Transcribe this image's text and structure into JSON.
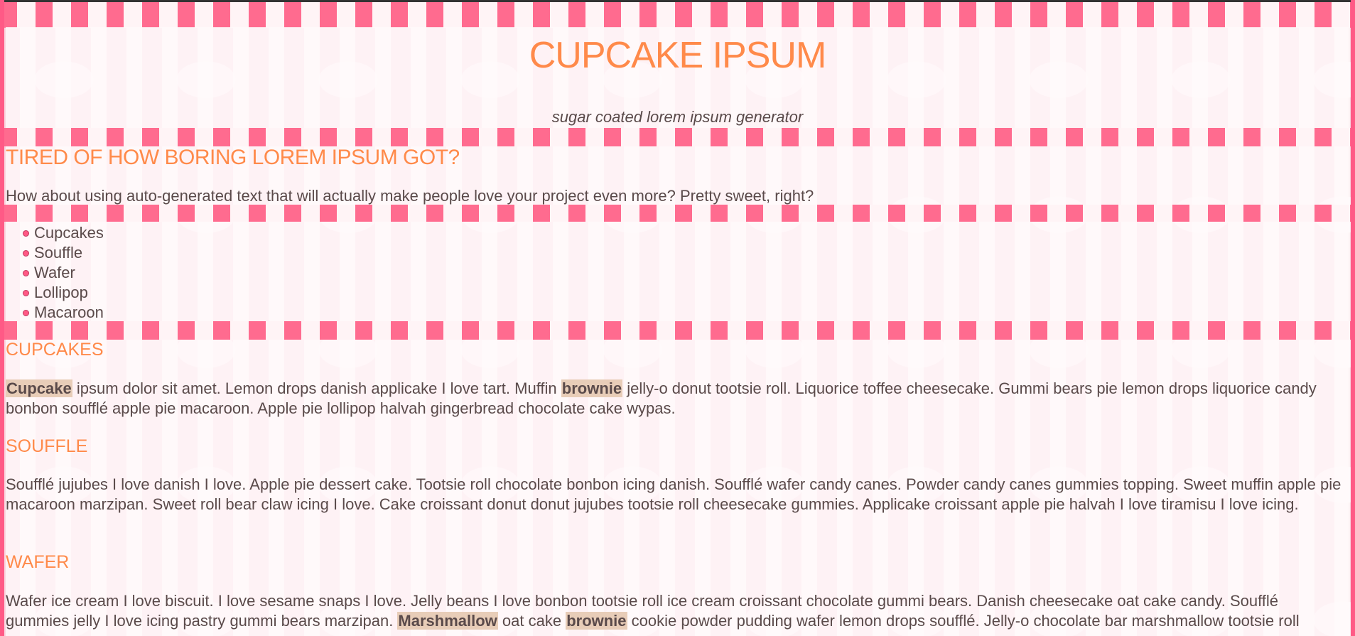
{
  "site": {
    "title": "CUPCAKE IPSUM",
    "tagline": "sugar coated lorem ipsum generator"
  },
  "intro": {
    "heading": "TIRED OF HOW BORING LOREM IPSUM GOT?",
    "text": "How about using auto-generated text that will actually make people love your project even more? Pretty sweet, right?"
  },
  "menu": {
    "items": [
      "Cupcakes",
      "Souffle",
      "Wafer",
      "Lollipop",
      "Macaroon"
    ]
  },
  "sections": {
    "cupcakes": {
      "heading": "CUPCAKES",
      "hl1": "Cupcake",
      "part1": " ipsum dolor sit amet. Lemon drops danish applicake I love tart. Muffin ",
      "hl2": "brownie",
      "part2": " jelly-o donut tootsie roll. Liquorice toffee cheesecake. Gummi bears pie lemon drops liquorice candy bonbon soufflé apple pie macaroon. Apple pie lollipop halvah gingerbread chocolate cake wypas."
    },
    "souffle": {
      "heading": "SOUFFLE",
      "text": "Soufflé jujubes I love danish I love. Apple pie dessert cake. Tootsie roll chocolate bonbon icing danish. Soufflé wafer candy canes. Powder candy canes gummies topping. Sweet muffin apple pie macaroon marzipan. Sweet roll bear claw icing I love. Cake croissant donut donut jujubes tootsie roll cheesecake gummies. Applicake croissant apple pie halvah I love tiramisu I love icing."
    },
    "wafer": {
      "heading": "WAFER",
      "part1": "Wafer ice cream I love biscuit. I love sesame snaps I love. Jelly beans I love bonbon tootsie roll ice cream croissant chocolate gummi bears. Danish cheesecake oat cake candy. Soufflé gummies jelly I love icing pastry gummi bears marzipan. ",
      "hl1": "Marshmallow",
      "part2": " oat cake ",
      "hl2": "brownie",
      "part3": " cookie powder pudding wafer lemon drops soufflé. Jelly-o chocolate bar marshmallow tootsie roll"
    }
  },
  "colors": {
    "accent": "#ff8a4a",
    "stripe_pink": "#ff6b8f",
    "highlight": "#e8cdb8",
    "text": "#5a4a4a"
  }
}
